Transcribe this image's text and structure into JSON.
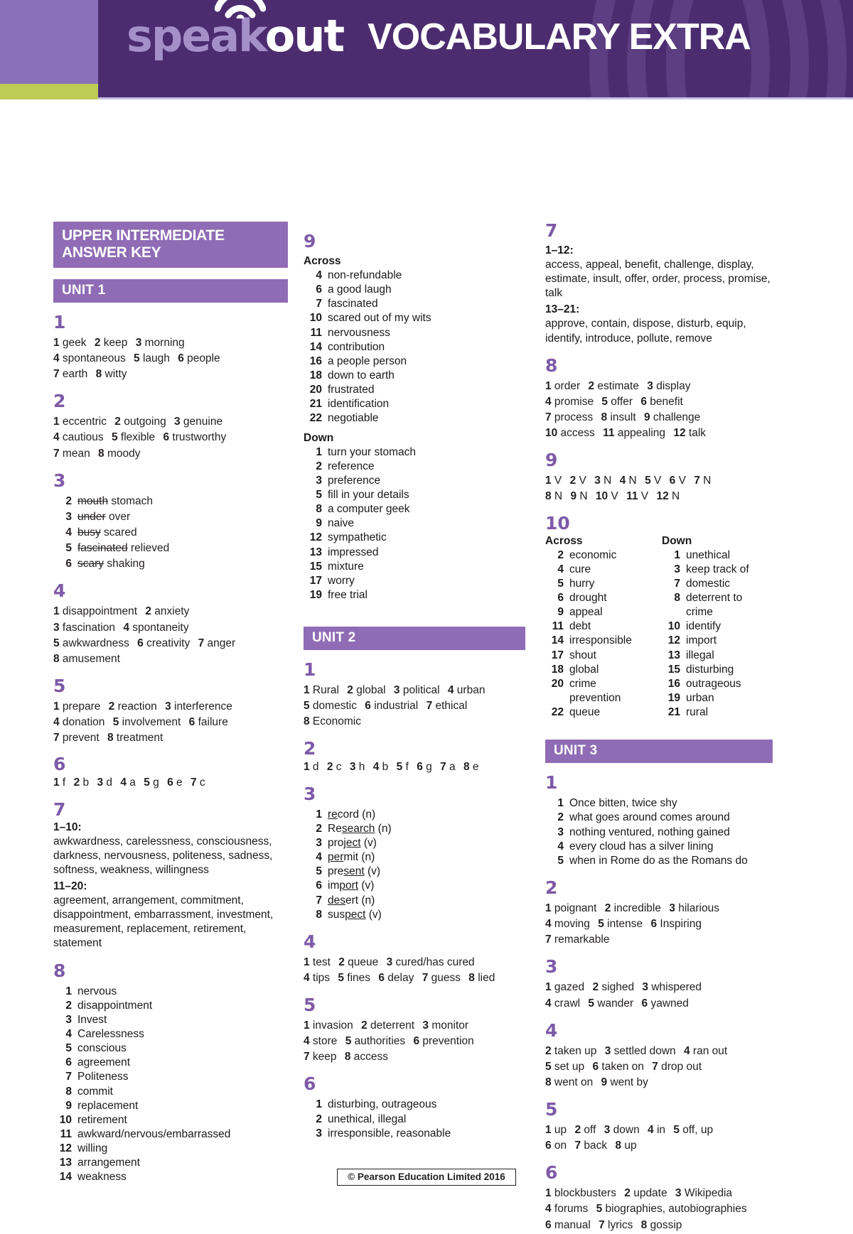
{
  "header": {
    "logo_speak": "speak",
    "logo_out": "out",
    "title": "VOCABULARY EXTRA",
    "wifi_icon": "wifi-arc-icon"
  },
  "answer_key_title": "UPPER INTERMEDIATE ANSWER KEY",
  "footer": {
    "copyright": "© Pearson Education Limited 2016"
  },
  "colors": {
    "purple": "#4b2d6f",
    "bar": "#8f6cb5",
    "accent": "#7e5aa8",
    "green": "#bccc55"
  },
  "units": {
    "unit1": "UNIT 1",
    "unit2": "UNIT 2",
    "unit3": "UNIT 3"
  },
  "labels": {
    "across": "Across",
    "down": "Down"
  },
  "u1": {
    "ex1": {
      "num": "1",
      "lines": [
        [
          [
            "1",
            "geek"
          ],
          [
            "2",
            "keep"
          ],
          [
            "3",
            "morning"
          ]
        ],
        [
          [
            "4",
            "spontaneous"
          ],
          [
            "5",
            "laugh"
          ],
          [
            "6",
            "people"
          ]
        ],
        [
          [
            "7",
            "earth"
          ],
          [
            "8",
            "witty"
          ]
        ]
      ]
    },
    "ex2": {
      "num": "2",
      "lines": [
        [
          [
            "1",
            "eccentric"
          ],
          [
            "2",
            "outgoing"
          ],
          [
            "3",
            "genuine"
          ]
        ],
        [
          [
            "4",
            "cautious"
          ],
          [
            "5",
            "flexible"
          ],
          [
            "6",
            "trustworthy"
          ]
        ],
        [
          [
            "7",
            "mean"
          ],
          [
            "8",
            "moody"
          ]
        ]
      ]
    },
    "ex3": {
      "num": "3",
      "items": [
        {
          "n": "2",
          "wrong": "mouth",
          "right": "stomach"
        },
        {
          "n": "3",
          "wrong": "under",
          "right": "over"
        },
        {
          "n": "4",
          "wrong": "busy",
          "right": "scared"
        },
        {
          "n": "5",
          "wrong": "fascinated",
          "right": "relieved"
        },
        {
          "n": "6",
          "wrong": "scary",
          "right": "shaking"
        }
      ]
    },
    "ex4": {
      "num": "4",
      "lines": [
        [
          [
            "1",
            "disappointment"
          ],
          [
            "2",
            "anxiety"
          ]
        ],
        [
          [
            "3",
            "fascination"
          ],
          [
            "4",
            "spontaneity"
          ]
        ],
        [
          [
            "5",
            "awkwardness"
          ],
          [
            "6",
            "creativity"
          ],
          [
            "7",
            "anger"
          ]
        ],
        [
          [
            "8",
            "amusement"
          ]
        ]
      ]
    },
    "ex5": {
      "num": "5",
      "lines": [
        [
          [
            "1",
            "prepare"
          ],
          [
            "2",
            "reaction"
          ],
          [
            "3",
            "interference"
          ]
        ],
        [
          [
            "4",
            "donation"
          ],
          [
            "5",
            "involvement"
          ],
          [
            "6",
            "failure"
          ]
        ],
        [
          [
            "7",
            "prevent"
          ],
          [
            "8",
            "treatment"
          ]
        ]
      ]
    },
    "ex6": {
      "num": "6",
      "lines": [
        [
          [
            "1",
            "f"
          ],
          [
            "2",
            "b"
          ],
          [
            "3",
            "d"
          ],
          [
            "4",
            "a"
          ],
          [
            "5",
            "g"
          ],
          [
            "6",
            "e"
          ],
          [
            "7",
            "c"
          ]
        ]
      ]
    },
    "ex7": {
      "num": "7",
      "sub1": "1–10:",
      "text1": "awkwardness, carelessness, consciousness, darkness, nervousness, politeness, sadness, softness, weakness, willingness",
      "sub2": "11–20:",
      "text2": "agreement, arrangement, commitment, disappointment, embarrassment, investment, measurement, replacement, retirement, statement"
    },
    "ex8": {
      "num": "8",
      "items": [
        {
          "n": "1",
          "t": "nervous"
        },
        {
          "n": "2",
          "t": "disappointment"
        },
        {
          "n": "3",
          "t": "Invest"
        },
        {
          "n": "4",
          "t": "Carelessness"
        },
        {
          "n": "5",
          "t": "conscious"
        },
        {
          "n": "6",
          "t": "agreement"
        },
        {
          "n": "7",
          "t": "Politeness"
        },
        {
          "n": "8",
          "t": "commit"
        },
        {
          "n": "9",
          "t": "replacement"
        },
        {
          "n": "10",
          "t": "retirement"
        },
        {
          "n": "11",
          "t": "awkward/nervous/embarrassed"
        },
        {
          "n": "12",
          "t": "willing"
        },
        {
          "n": "13",
          "t": "arrangement"
        },
        {
          "n": "14",
          "t": "weakness"
        }
      ]
    },
    "ex9": {
      "num": "9",
      "across": [
        {
          "n": "4",
          "t": "non-refundable"
        },
        {
          "n": "6",
          "t": "a good laugh"
        },
        {
          "n": "7",
          "t": "fascinated"
        },
        {
          "n": "10",
          "t": "scared out of my wits"
        },
        {
          "n": "11",
          "t": "nervousness"
        },
        {
          "n": "14",
          "t": "contribution"
        },
        {
          "n": "16",
          "t": "a people person"
        },
        {
          "n": "18",
          "t": "down to earth"
        },
        {
          "n": "20",
          "t": "frustrated"
        },
        {
          "n": "21",
          "t": "identification"
        },
        {
          "n": "22",
          "t": "negotiable"
        }
      ],
      "down": [
        {
          "n": "1",
          "t": "turn your stomach"
        },
        {
          "n": "2",
          "t": "reference"
        },
        {
          "n": "3",
          "t": "preference"
        },
        {
          "n": "5",
          "t": "fill in your details"
        },
        {
          "n": "8",
          "t": "a computer geek"
        },
        {
          "n": "9",
          "t": "naive"
        },
        {
          "n": "12",
          "t": "sympathetic"
        },
        {
          "n": "13",
          "t": "impressed"
        },
        {
          "n": "15",
          "t": "mixture"
        },
        {
          "n": "17",
          "t": "worry"
        },
        {
          "n": "19",
          "t": "free trial"
        }
      ]
    }
  },
  "u2": {
    "ex1": {
      "num": "1",
      "lines": [
        [
          [
            "1",
            "Rural"
          ],
          [
            "2",
            "global"
          ],
          [
            "3",
            "political"
          ],
          [
            "4",
            "urban"
          ]
        ],
        [
          [
            "5",
            "domestic"
          ],
          [
            "6",
            "industrial"
          ],
          [
            "7",
            "ethical"
          ]
        ],
        [
          [
            "8",
            "Economic"
          ]
        ]
      ]
    },
    "ex2": {
      "num": "2",
      "lines": [
        [
          [
            "1",
            "d"
          ],
          [
            "2",
            "c"
          ],
          [
            "3",
            "h"
          ],
          [
            "4",
            "b"
          ],
          [
            "5",
            "f"
          ],
          [
            "6",
            "g"
          ],
          [
            "7",
            "a"
          ],
          [
            "8",
            "e"
          ]
        ]
      ]
    },
    "ex3": {
      "num": "3",
      "items": [
        {
          "n": "1",
          "pre": "",
          "str": "re",
          "post": "cord",
          "tag": "(n)"
        },
        {
          "n": "2",
          "pre": "Re",
          "str": "search",
          "post": "",
          "tag": "(n)"
        },
        {
          "n": "3",
          "pre": "pro",
          "str": "ject",
          "post": "",
          "tag": "(v)"
        },
        {
          "n": "4",
          "pre": "",
          "str": "per",
          "post": "mit",
          "tag": "(n)"
        },
        {
          "n": "5",
          "pre": "pre",
          "str": "sent",
          "post": "",
          "tag": "(v)"
        },
        {
          "n": "6",
          "pre": "im",
          "str": "port",
          "post": "",
          "tag": "(v)"
        },
        {
          "n": "7",
          "pre": "",
          "str": "des",
          "post": "ert",
          "tag": "(n)"
        },
        {
          "n": "8",
          "pre": "sus",
          "str": "pect",
          "post": "",
          "tag": "(v)"
        }
      ]
    },
    "ex4": {
      "num": "4",
      "lines": [
        [
          [
            "1",
            "test"
          ],
          [
            "2",
            "queue"
          ],
          [
            "3",
            "cured/has cured"
          ]
        ],
        [
          [
            "4",
            "tips"
          ],
          [
            "5",
            "fines"
          ],
          [
            "6",
            "delay"
          ],
          [
            "7",
            "guess"
          ],
          [
            "8",
            "lied"
          ]
        ]
      ]
    },
    "ex5": {
      "num": "5",
      "lines": [
        [
          [
            "1",
            "invasion"
          ],
          [
            "2",
            "deterrent"
          ],
          [
            "3",
            "monitor"
          ]
        ],
        [
          [
            "4",
            "store"
          ],
          [
            "5",
            "authorities"
          ],
          [
            "6",
            "prevention"
          ]
        ],
        [
          [
            "7",
            "keep"
          ],
          [
            "8",
            "access"
          ]
        ]
      ]
    },
    "ex6": {
      "num": "6",
      "items": [
        {
          "n": "1",
          "t": "disturbing, outrageous"
        },
        {
          "n": "2",
          "t": "unethical, illegal"
        },
        {
          "n": "3",
          "t": "irresponsible, reasonable"
        }
      ]
    },
    "ex7": {
      "num": "7",
      "sub1": "1–12:",
      "text1": "access, appeal, benefit, challenge, display, estimate, insult, offer, order, process, promise, talk",
      "sub2": "13–21:",
      "text2": "approve, contain, dispose, disturb, equip, identify, introduce, pollute, remove"
    },
    "ex8": {
      "num": "8",
      "lines": [
        [
          [
            "1",
            "order"
          ],
          [
            "2",
            "estimate"
          ],
          [
            "3",
            "display"
          ]
        ],
        [
          [
            "4",
            "promise"
          ],
          [
            "5",
            "offer"
          ],
          [
            "6",
            "benefit"
          ]
        ],
        [
          [
            "7",
            "process"
          ],
          [
            "8",
            "insult"
          ],
          [
            "9",
            "challenge"
          ]
        ],
        [
          [
            "10",
            "access"
          ],
          [
            "11",
            "appealing"
          ],
          [
            "12",
            "talk"
          ]
        ]
      ]
    },
    "ex9": {
      "num": "9",
      "lines": [
        [
          [
            "1",
            "V"
          ],
          [
            "2",
            "V"
          ],
          [
            "3",
            "N"
          ],
          [
            "4",
            "N"
          ],
          [
            "5",
            "V"
          ],
          [
            "6",
            "V"
          ],
          [
            "7",
            "N"
          ]
        ],
        [
          [
            "8",
            "N"
          ],
          [
            "9",
            "N"
          ],
          [
            "10",
            "V"
          ],
          [
            "11",
            "V"
          ],
          [
            "12",
            "N"
          ]
        ]
      ]
    },
    "ex10": {
      "num": "10",
      "across": [
        {
          "n": "2",
          "t": "economic"
        },
        {
          "n": "4",
          "t": "cure"
        },
        {
          "n": "5",
          "t": "hurry"
        },
        {
          "n": "6",
          "t": "drought"
        },
        {
          "n": "9",
          "t": "appeal"
        },
        {
          "n": "11",
          "t": "debt"
        },
        {
          "n": "14",
          "t": "irresponsible"
        },
        {
          "n": "17",
          "t": "shout"
        },
        {
          "n": "18",
          "t": "global"
        },
        {
          "n": "20",
          "t": "crime prevention"
        },
        {
          "n": "22",
          "t": "queue"
        }
      ],
      "down": [
        {
          "n": "1",
          "t": "unethical"
        },
        {
          "n": "3",
          "t": "keep track of"
        },
        {
          "n": "7",
          "t": "domestic"
        },
        {
          "n": "8",
          "t": "deterrent to crime"
        },
        {
          "n": "10",
          "t": "identify"
        },
        {
          "n": "12",
          "t": "import"
        },
        {
          "n": "13",
          "t": "illegal"
        },
        {
          "n": "15",
          "t": "disturbing"
        },
        {
          "n": "16",
          "t": "outrageous"
        },
        {
          "n": "19",
          "t": "urban"
        },
        {
          "n": "21",
          "t": "rural"
        }
      ]
    }
  },
  "u3": {
    "ex1": {
      "num": "1",
      "items": [
        {
          "n": "1",
          "t": "Once bitten, twice shy"
        },
        {
          "n": "2",
          "t": "what goes around comes around"
        },
        {
          "n": "3",
          "t": "nothing ventured, nothing gained"
        },
        {
          "n": "4",
          "t": "every cloud has a silver lining"
        },
        {
          "n": "5",
          "t": "when in Rome do as the Romans do"
        }
      ]
    },
    "ex2": {
      "num": "2",
      "lines": [
        [
          [
            "1",
            "poignant"
          ],
          [
            "2",
            "incredible"
          ],
          [
            "3",
            "hilarious"
          ]
        ],
        [
          [
            "4",
            "moving"
          ],
          [
            "5",
            "intense"
          ],
          [
            "6",
            "Inspiring"
          ]
        ],
        [
          [
            "7",
            "remarkable"
          ]
        ]
      ]
    },
    "ex3": {
      "num": "3",
      "lines": [
        [
          [
            "1",
            "gazed"
          ],
          [
            "2",
            "sighed"
          ],
          [
            "3",
            "whispered"
          ]
        ],
        [
          [
            "4",
            "crawl"
          ],
          [
            "5",
            "wander"
          ],
          [
            "6",
            "yawned"
          ]
        ]
      ]
    },
    "ex4": {
      "num": "4",
      "lines": [
        [
          [
            "2",
            "taken up"
          ],
          [
            "3",
            "settled down"
          ],
          [
            "4",
            "ran out"
          ]
        ],
        [
          [
            "5",
            "set up"
          ],
          [
            "6",
            "taken on"
          ],
          [
            "7",
            "drop out"
          ]
        ],
        [
          [
            "8",
            "went on"
          ],
          [
            "9",
            "went by"
          ]
        ]
      ]
    },
    "ex5": {
      "num": "5",
      "lines": [
        [
          [
            "1",
            "up"
          ],
          [
            "2",
            "off"
          ],
          [
            "3",
            "down"
          ],
          [
            "4",
            "in"
          ],
          [
            "5",
            "off, up"
          ]
        ],
        [
          [
            "6",
            "on"
          ],
          [
            "7",
            "back"
          ],
          [
            "8",
            "up"
          ]
        ]
      ]
    },
    "ex6": {
      "num": "6",
      "lines": [
        [
          [
            "1",
            "blockbusters"
          ],
          [
            "2",
            "update"
          ],
          [
            "3",
            "Wikipedia"
          ]
        ],
        [
          [
            "4",
            "forums"
          ],
          [
            "5",
            "biographies, autobiographies"
          ]
        ],
        [
          [
            "6",
            "manual"
          ],
          [
            "7",
            "lyrics"
          ],
          [
            "8",
            "gossip"
          ]
        ]
      ]
    }
  }
}
